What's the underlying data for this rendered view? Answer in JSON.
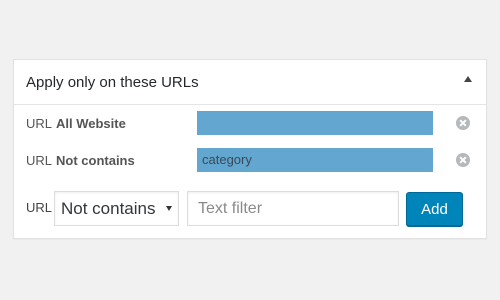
{
  "panel": {
    "title": "Apply only on these URLs",
    "toggle_icon": "triangle-up-icon"
  },
  "rules": [
    {
      "type": "URL",
      "condition": "All Website",
      "value": "",
      "remove_icon": "close-circle-icon"
    },
    {
      "type": "URL",
      "condition": "Not contains",
      "value": "category",
      "remove_icon": "close-circle-icon"
    }
  ],
  "add_rule": {
    "type_label": "URL",
    "condition_selected": "Not contains",
    "filter_value": "",
    "filter_placeholder": "Text filter",
    "add_label": "Add"
  },
  "colors": {
    "background": "#f1f1f1",
    "value_highlight": "#63a6d0",
    "primary_button": "#0085ba"
  }
}
